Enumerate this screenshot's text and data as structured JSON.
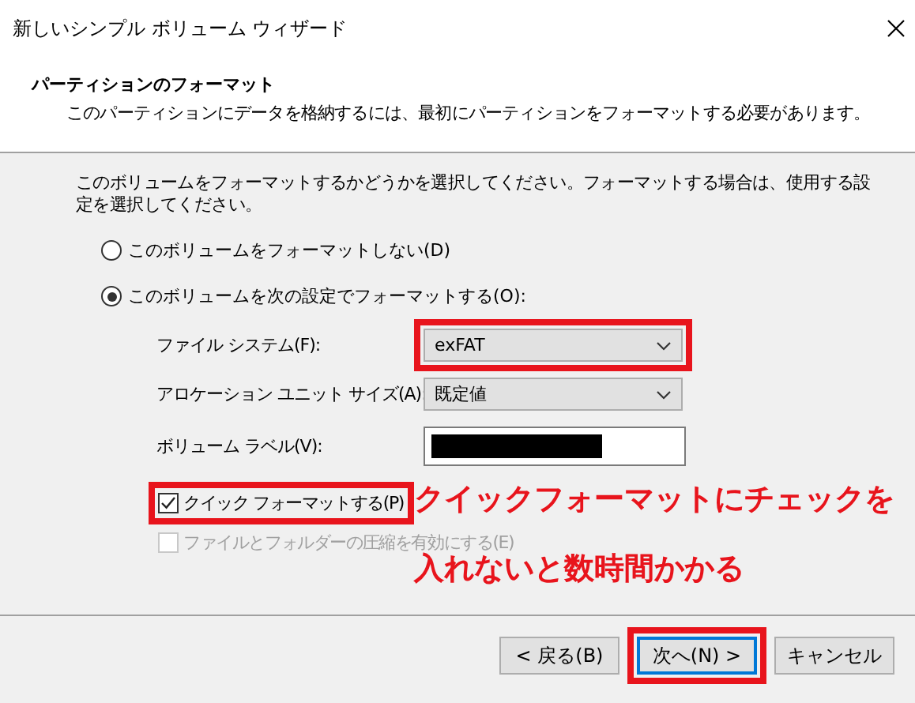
{
  "window": {
    "title": "新しいシンプル ボリューム ウィザード"
  },
  "header": {
    "title": "パーティションのフォーマット",
    "description": "このパーティションにデータを格納するには、最初にパーティションをフォーマットする必要があります。"
  },
  "instructions": "このボリュームをフォーマットするかどうかを選択してください。フォーマットする場合は、使用する設定を選択してください。",
  "format_options": [
    {
      "label": "このボリュームをフォーマットしない(D)",
      "selected": false
    },
    {
      "label": "このボリュームを次の設定でフォーマットする(O):",
      "selected": true
    }
  ],
  "settings": [
    {
      "kind": "dropdown",
      "label": "ファイル システム(F):",
      "value": "exFAT",
      "highlighted": true
    },
    {
      "kind": "dropdown",
      "label": "アロケーション ユニット サイズ(A):",
      "value": "既定値",
      "highlighted": false
    },
    {
      "kind": "text",
      "label": "ボリューム ラベル(V):",
      "redacted": true,
      "highlighted": false
    }
  ],
  "checkboxes": [
    {
      "label": "クイック フォーマットする(P)",
      "checked": true,
      "disabled": false,
      "highlighted": true
    },
    {
      "label": "ファイルとフォルダーの圧縮を有効にする(E)",
      "checked": false,
      "disabled": true,
      "highlighted": false
    }
  ],
  "buttons": [
    {
      "label": "< 戻る(B)",
      "default": false,
      "highlighted": false
    },
    {
      "label": "次へ(N) >",
      "default": true,
      "highlighted": true
    },
    {
      "label": "キャンセル",
      "default": false,
      "highlighted": false
    }
  ],
  "annotation": {
    "lines": [
      "クイックフォーマットにチェックを",
      "入れないと数時間かかる"
    ]
  }
}
